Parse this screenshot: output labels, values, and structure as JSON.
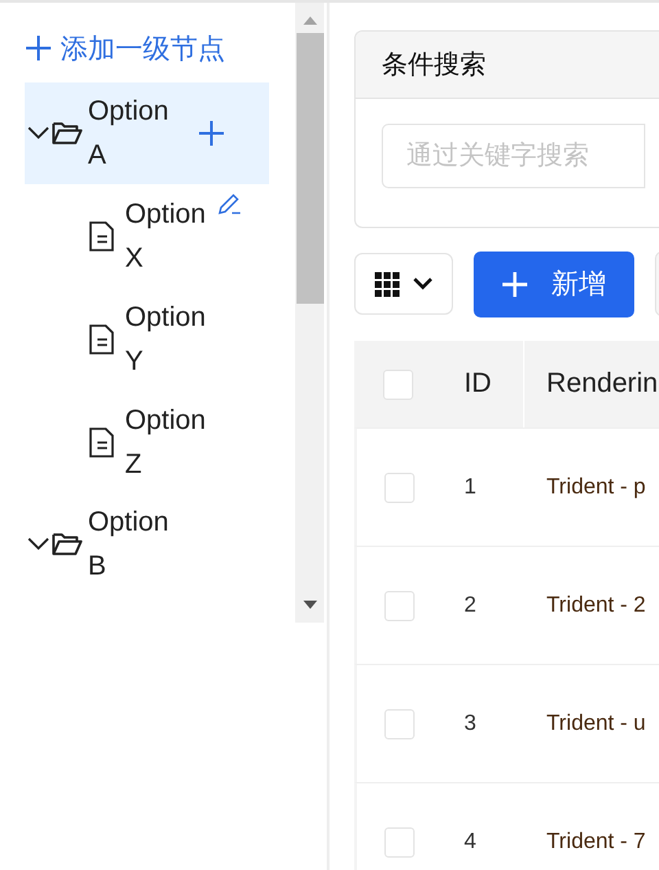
{
  "add_root_button": "添加一级节点",
  "tree": [
    {
      "label": "Option A",
      "expanded": true,
      "selected": true,
      "children": [
        {
          "label": "Option X",
          "selected": false,
          "hovered": true
        },
        {
          "label": "Option Y",
          "selected": false,
          "hovered": false
        },
        {
          "label": "Option Z",
          "selected": false,
          "hovered": false
        }
      ]
    },
    {
      "label": "Option B",
      "expanded": true,
      "selected": false
    }
  ],
  "search_card": {
    "title": "条件搜索",
    "placeholder": "通过关键字搜索"
  },
  "toolbar": {
    "add_button": "新增"
  },
  "table": {
    "header_checked": false,
    "columns": [
      "ID",
      "Renderin"
    ],
    "rows": [
      {
        "id": "1",
        "engine": "Trident - p",
        "checked": false
      },
      {
        "id": "2",
        "engine": "Trident - 2",
        "checked": false
      },
      {
        "id": "3",
        "engine": "Trident - u",
        "checked": false
      },
      {
        "id": "4",
        "engine": "Trident - 7",
        "checked": false
      }
    ]
  }
}
